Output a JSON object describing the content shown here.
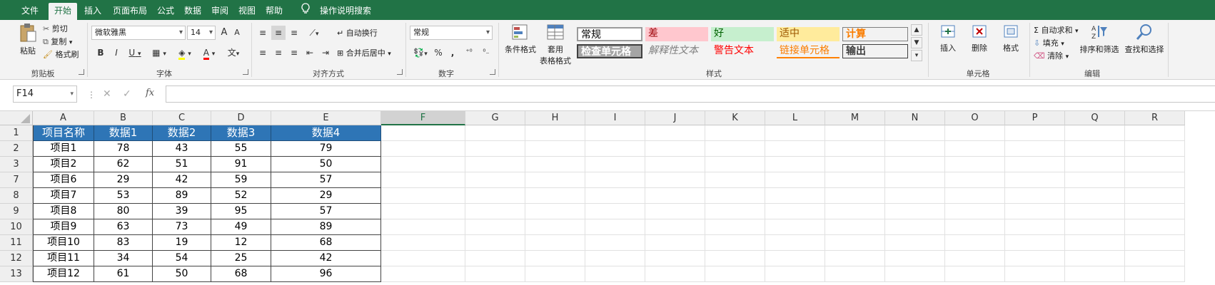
{
  "menu": {
    "tabs": [
      "文件",
      "开始",
      "插入",
      "页面布局",
      "公式",
      "数据",
      "审阅",
      "视图",
      "帮助"
    ],
    "active": "开始",
    "tell_me": "操作说明搜索"
  },
  "ribbon": {
    "clipboard": {
      "paste": "粘贴",
      "cut": "剪切",
      "copy": "复制",
      "format_painter": "格式刷",
      "label": "剪贴板"
    },
    "font": {
      "name": "微软雅黑",
      "size": "14",
      "bold": "B",
      "italic": "I",
      "underline": "U",
      "label": "字体",
      "grow": "A",
      "shrink": "A"
    },
    "alignment": {
      "wrap": "自动换行",
      "merge": "合并后居中",
      "label": "对齐方式"
    },
    "number": {
      "format": "常规",
      "percent": "%",
      "comma": ",",
      "label": "数字"
    },
    "styles": {
      "conditional": "条件格式",
      "table1": "套用",
      "table2": "表格格式",
      "cells": [
        {
          "text": "常规"
        },
        {
          "text": "差"
        },
        {
          "text": "好"
        },
        {
          "text": "适中"
        },
        {
          "text": "计算"
        },
        {
          "text": "检查单元格"
        },
        {
          "text": "解释性文本"
        },
        {
          "text": "警告文本"
        },
        {
          "text": "链接单元格"
        },
        {
          "text": "输出"
        }
      ],
      "label": "样式"
    },
    "cells_group": {
      "insert": "插入",
      "delete": "删除",
      "format": "格式",
      "label": "单元格"
    },
    "editing": {
      "autosum": "自动求和",
      "fill": "填充",
      "clear": "清除",
      "sort": "排序和筛选",
      "find": "查找和选择",
      "label": "编辑"
    }
  },
  "formula_bar": {
    "name_box": "F14",
    "fx": "fx",
    "content": ""
  },
  "columns": [
    "A",
    "B",
    "C",
    "D",
    "E",
    "F",
    "G",
    "H",
    "I",
    "J",
    "K",
    "L",
    "M",
    "N",
    "O",
    "P",
    "Q",
    "R"
  ],
  "selected_column": "F",
  "rows": [
    "1",
    "2",
    "3",
    "7",
    "8",
    "9",
    "10",
    "11",
    "12",
    "13"
  ],
  "table": {
    "header": [
      "项目名称",
      "数据1",
      "数据2",
      "数据3",
      "数据4"
    ],
    "data": [
      [
        "项目1",
        "78",
        "43",
        "55",
        "79"
      ],
      [
        "项目2",
        "62",
        "51",
        "91",
        "50"
      ],
      [
        "项目6",
        "29",
        "42",
        "59",
        "57"
      ],
      [
        "项目7",
        "53",
        "89",
        "52",
        "29"
      ],
      [
        "项目8",
        "80",
        "39",
        "95",
        "57"
      ],
      [
        "项目9",
        "63",
        "73",
        "49",
        "89"
      ],
      [
        "项目10",
        "83",
        "19",
        "12",
        "68"
      ],
      [
        "项目11",
        "34",
        "54",
        "25",
        "42"
      ],
      [
        "项目12",
        "61",
        "50",
        "68",
        "96"
      ]
    ]
  }
}
